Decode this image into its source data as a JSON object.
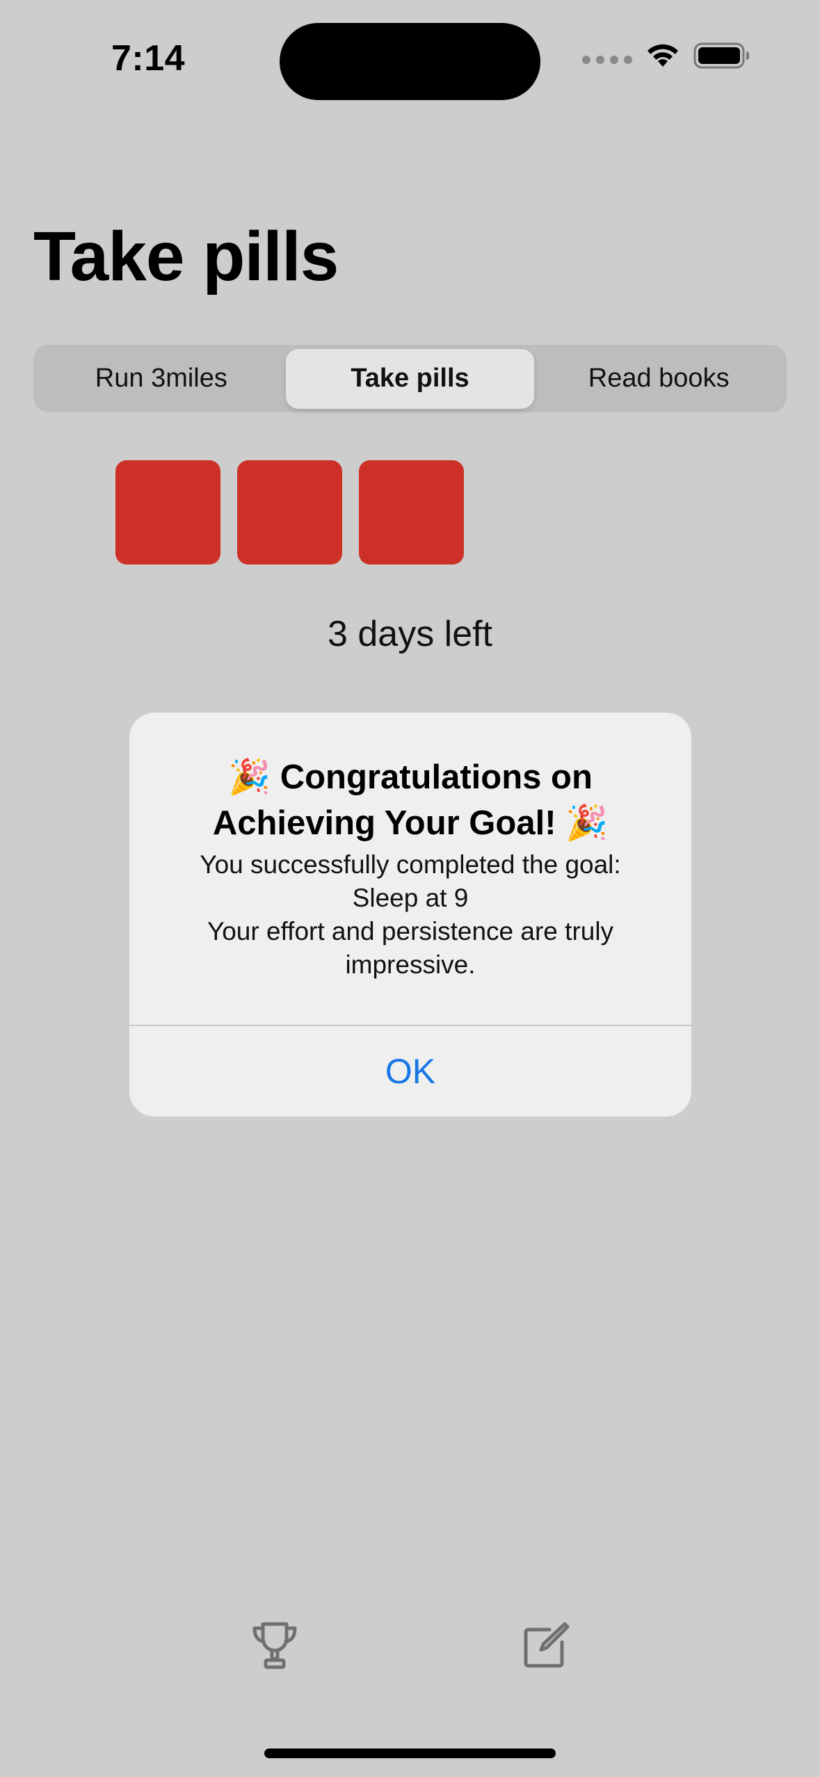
{
  "status_bar": {
    "time": "7:14"
  },
  "page": {
    "title": "Take pills"
  },
  "segments": [
    {
      "label": "Run 3miles",
      "selected": false
    },
    {
      "label": "Take pills",
      "selected": true
    },
    {
      "label": "Read books",
      "selected": false
    }
  ],
  "progress": {
    "completed_days": 3,
    "days_left_text": "3 days left",
    "square_color": "#cc3026"
  },
  "alert": {
    "title": "🎉 Congratulations on Achieving Your Goal! 🎉",
    "message_line1": "You successfully completed the goal:",
    "message_line2": "Sleep at 9",
    "message_line3": "Your effort and persistence are truly impressive.",
    "ok_label": "OK",
    "ok_color": "#1877e6"
  },
  "toolbar": {
    "left_icon": "trophy-icon",
    "right_icon": "compose-icon"
  }
}
